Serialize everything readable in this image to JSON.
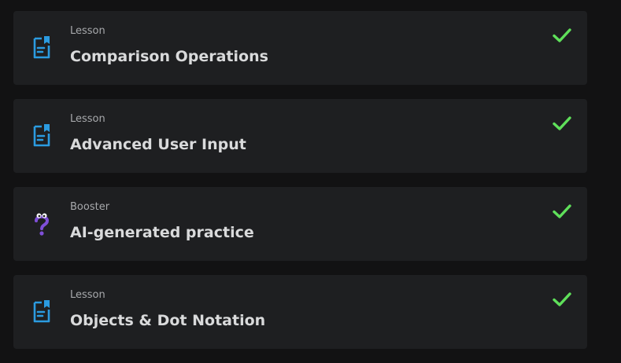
{
  "items": [
    {
      "type": "Lesson",
      "title": "Comparison Operations",
      "icon": "lesson-document-icon",
      "completed": true
    },
    {
      "type": "Lesson",
      "title": "Advanced User Input",
      "icon": "lesson-document-icon",
      "completed": true
    },
    {
      "type": "Booster",
      "title": "AI-generated practice",
      "icon": "booster-question-icon",
      "completed": true
    },
    {
      "type": "Lesson",
      "title": "Objects & Dot Notation",
      "icon": "lesson-document-icon",
      "completed": true
    }
  ],
  "colors": {
    "background": "#121213",
    "card": "#1e1f21",
    "lesson_icon": "#2b9be0",
    "booster_icon": "#7f4fd8",
    "check": "#5fe05a",
    "title": "#d9dadb",
    "subtitle": "#a7a9ac"
  }
}
